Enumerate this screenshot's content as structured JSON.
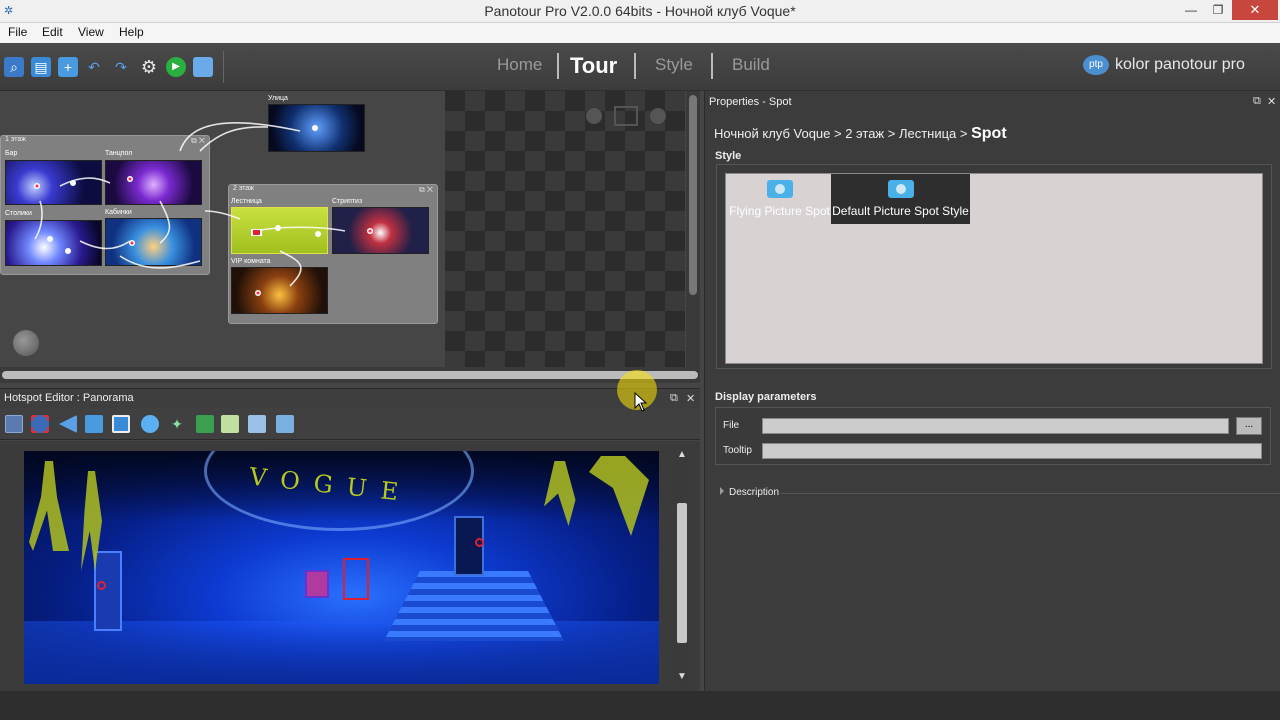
{
  "window": {
    "title": "Panotour Pro V2.0.0 64bits - Ночной клуб Voque*"
  },
  "menu": [
    "File",
    "Edit",
    "View",
    "Help"
  ],
  "toolbar": {
    "icons": [
      "zoom-tool-icon",
      "save-icon",
      "add-panorama-icon",
      "undo-icon",
      "redo-icon",
      "settings-icon",
      "play-icon",
      "folder-icon"
    ],
    "nav": [
      "Home",
      "Tour",
      "Style",
      "Build"
    ],
    "active_tab": "Tour",
    "brand": "kolor panotour pro",
    "brand_logo": "ptp"
  },
  "graph": {
    "groups": [
      {
        "label": "1 этаж"
      },
      {
        "label": "2 этаж"
      }
    ],
    "nodes": [
      "Улица",
      "Бар",
      "Танцпол",
      "Столики",
      "Кабинки",
      "Лестница",
      "Стриптиз",
      "VIP комната"
    ]
  },
  "hotspot_editor": {
    "title": "Hotspot Editor : Panorama",
    "pano_text": "VOGUE"
  },
  "properties": {
    "title": "Properties - Spot",
    "crumb_path": "Ночной клуб Voque > 2 этаж > Лестница > ",
    "crumb_current": "Spot",
    "style_label": "Style",
    "styles": [
      {
        "label": "Flying Picture Spot",
        "selected": false
      },
      {
        "label": "Default Picture Spot Style",
        "selected": true
      }
    ],
    "display_label": "Display parameters",
    "file_label": "File",
    "file_value": "",
    "browse_label": "...",
    "tooltip_label": "Tooltip",
    "tooltip_value": "",
    "description_label": "Description"
  }
}
